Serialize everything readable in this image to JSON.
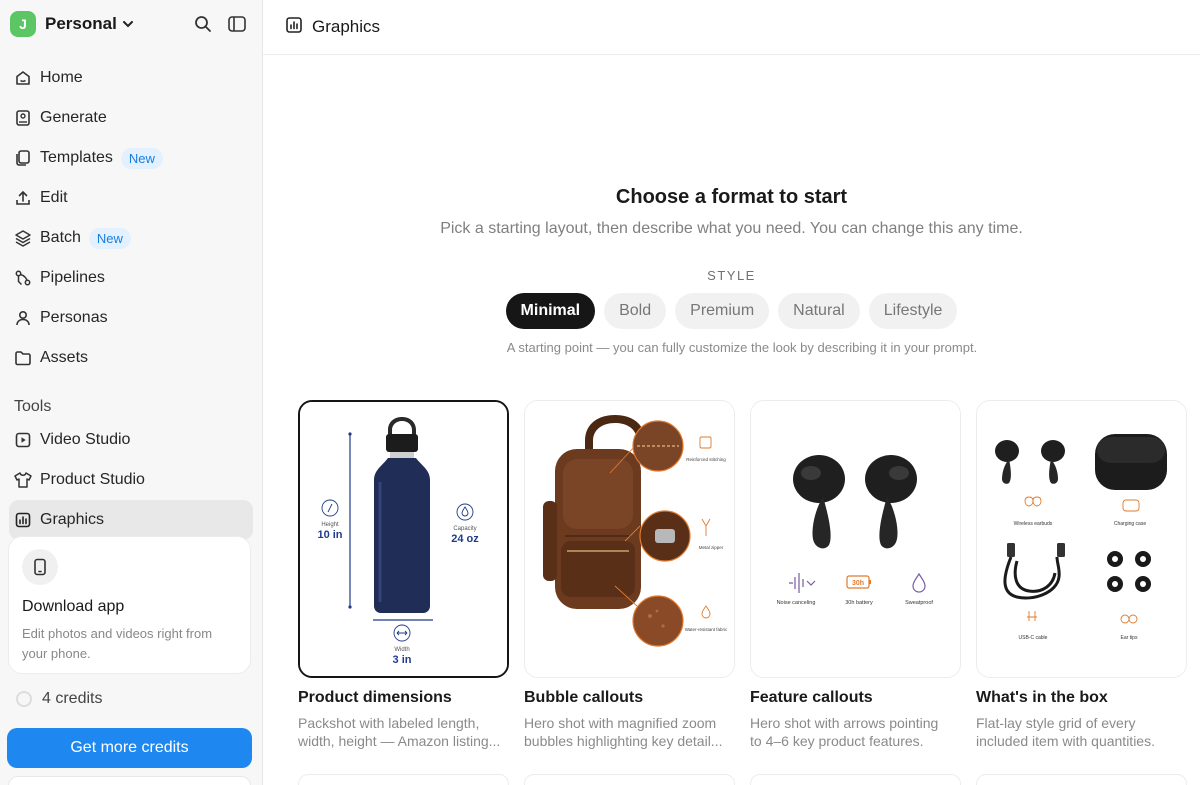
{
  "workspace": {
    "initial": "J",
    "name": "Personal"
  },
  "sidebar": {
    "items": [
      {
        "label": "Home",
        "icon": "home-icon"
      },
      {
        "label": "Generate",
        "icon": "image-icon"
      },
      {
        "label": "Templates",
        "icon": "copy-icon",
        "badge": "New"
      },
      {
        "label": "Edit",
        "icon": "upload-icon"
      },
      {
        "label": "Batch",
        "icon": "layers-icon",
        "badge": "New"
      },
      {
        "label": "Pipelines",
        "icon": "route-icon"
      },
      {
        "label": "Personas",
        "icon": "user-icon"
      },
      {
        "label": "Assets",
        "icon": "folder-icon"
      }
    ],
    "tools_title": "Tools",
    "tools": [
      {
        "label": "Video Studio",
        "icon": "video-icon"
      },
      {
        "label": "Product Studio",
        "icon": "shirt-icon"
      },
      {
        "label": "Graphics",
        "icon": "chart-icon",
        "active": true
      }
    ],
    "download": {
      "title": "Download app",
      "text_line1": "Edit photos and videos right from",
      "text_line2": "your phone."
    },
    "credits": "4 credits",
    "cta": "Get more credits"
  },
  "topbar": {
    "title": "Graphics"
  },
  "main": {
    "headline": "Choose a format to start",
    "subline": "Pick a starting layout, then describe what you need. You can change this any time.",
    "style_label": "STYLE",
    "styles": [
      "Minimal",
      "Bold",
      "Premium",
      "Natural",
      "Lifestyle"
    ],
    "active_style": "Minimal",
    "style_note": "A starting point — you can fully customize the look by describing it in your prompt.",
    "cards": [
      {
        "title": "Product dimensions",
        "desc_line1": "Packshot with labeled length,",
        "desc_line2": "width, height — Amazon listing..."
      },
      {
        "title": "Bubble callouts",
        "desc_line1": "Hero shot with magnified zoom",
        "desc_line2": "bubbles highlighting key detail..."
      },
      {
        "title": "Feature callouts",
        "desc_line1": "Hero shot with arrows pointing",
        "desc_line2": "to 4–6 key product features."
      },
      {
        "title": "What's in the box",
        "desc_line1": "Flat-lay style grid of every",
        "desc_line2": "included item with quantities."
      }
    ],
    "thumb1": {
      "height_label": "Height",
      "height_value": "10 in",
      "capacity_label": "Capacity",
      "capacity_value": "24 oz",
      "width_label": "Width",
      "width_value": "3 in"
    },
    "thumb2": {
      "c1": "Reinforced stitching",
      "c2": "Metal zipper",
      "c3": "Water-resistant fabric"
    },
    "thumb3": {
      "f1": "Noise canceling",
      "f2": "30h battery",
      "f2_badge": "30h",
      "f3": "Sweatproof"
    },
    "thumb4": {
      "i1": "Wireless earbuds",
      "i2": "Charging case",
      "i3": "USB-C cable",
      "i4": "Ear tips"
    }
  },
  "colors": {
    "accent": "#1e88f0",
    "avatar": "#5cc564",
    "badge_bg": "#e3f0fd",
    "badge_text": "#1a7de0",
    "active_pill": "#161616",
    "callout_orange": "#e07a2e",
    "bottle": "#1f2d57",
    "leather": "#6b3a1f"
  }
}
